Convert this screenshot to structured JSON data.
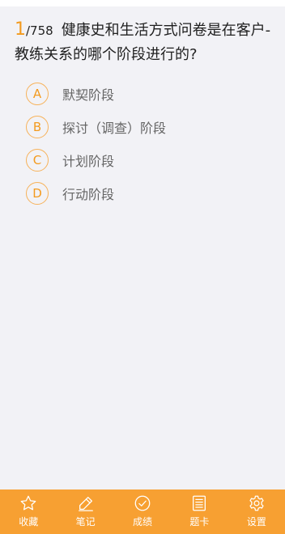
{
  "question": {
    "current": "1",
    "total": "/758",
    "text": "健康史和生活方式问卷是在客户-教练关系的哪个阶段进行的?"
  },
  "options": [
    {
      "letter": "A",
      "text": "默契阶段"
    },
    {
      "letter": "B",
      "text": "探讨（调查）阶段"
    },
    {
      "letter": "C",
      "text": "计划阶段"
    },
    {
      "letter": "D",
      "text": "行动阶段"
    }
  ],
  "bottom_nav": {
    "favorite": {
      "label": "收藏",
      "icon": "star-icon"
    },
    "notes": {
      "label": "笔记",
      "icon": "pencil-icon"
    },
    "score": {
      "label": "成绩",
      "icon": "check-circle-icon"
    },
    "answer_card": {
      "label": "题卡",
      "icon": "list-card-icon"
    },
    "settings": {
      "label": "设置",
      "icon": "gear-icon"
    }
  },
  "colors": {
    "accent": "#f39a1e",
    "bottom_bar": "#f7a032",
    "background": "#f2f2f6"
  }
}
